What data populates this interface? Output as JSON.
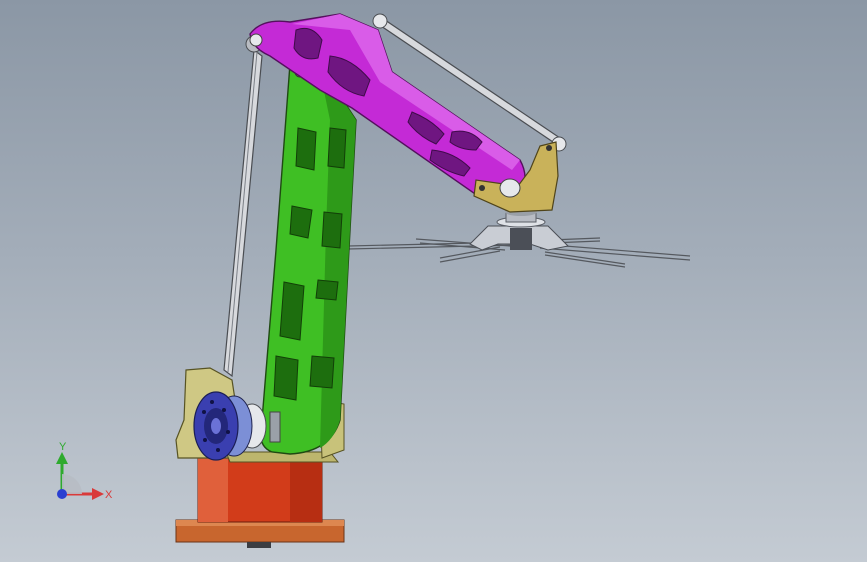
{
  "viewport": {
    "colors": {
      "background_top": "#8b97a5",
      "background_bottom": "#c4cbd3",
      "base_pedestal": "#d23c1a",
      "base_flange": "#c8662e",
      "shoulder_bracket": "#c8c27a",
      "lower_arm": "#37b51f",
      "upper_arm": "#c42ad6",
      "link_rods": "#8e939a",
      "joint_disc": "#3a3fb0",
      "wrist_bracket": "#c9b25a",
      "gripper": "#b8bcc4"
    }
  },
  "triad": {
    "y_label": "Y",
    "x_label": "X",
    "colors": {
      "y": "#2eaa2e",
      "x": "#d93a3a",
      "z": "#2a3fd1"
    }
  }
}
